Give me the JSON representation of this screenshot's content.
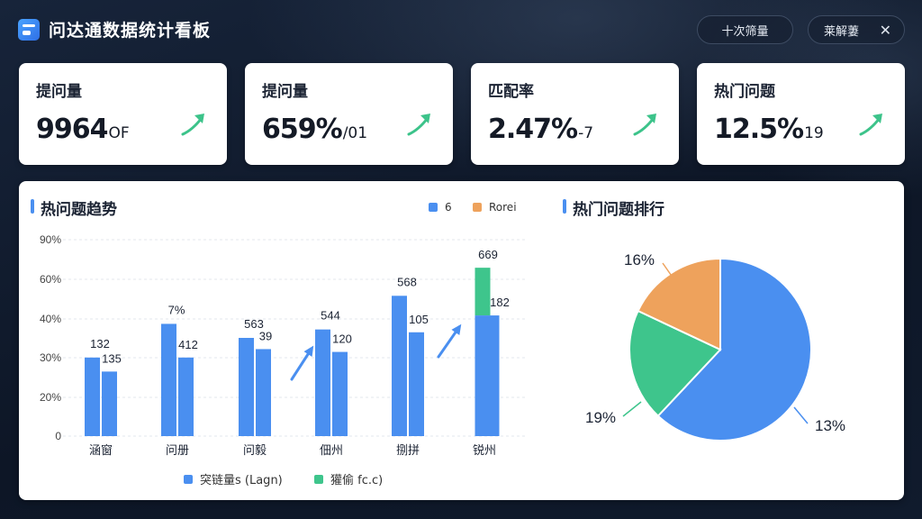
{
  "header": {
    "title": "问达通数据统计看板",
    "button_one": "十次筛量",
    "button_two": "莱解萋",
    "close_glyph": "✕"
  },
  "kpis": [
    {
      "label": "提问量",
      "value": "9964",
      "suffix": "OF",
      "trend_icon": "up-arrow-icon"
    },
    {
      "label": "提问量",
      "value": "659%",
      "suffix": "/01",
      "trend_icon": "up-arrow-icon"
    },
    {
      "label": "匹配率",
      "value": "2.47%",
      "suffix": "-7",
      "trend_icon": "up-arrow-icon"
    },
    {
      "label": "热门问题",
      "value": "12.5%",
      "suffix": "19",
      "trend_icon": "up-arrow-icon"
    }
  ],
  "trend_section": {
    "title": "热问题趋势",
    "legend_top": [
      {
        "label": "6",
        "color": "#4a8ff0"
      },
      {
        "label": "Rorei",
        "color": "#eea25c"
      }
    ],
    "legend_bottom": [
      {
        "label": "突链量s (Lagn)",
        "color": "#4a8ff0"
      },
      {
        "label": "獾偷 fc.c)",
        "color": "#3ec58c"
      }
    ]
  },
  "ranking_section": {
    "title": "热门问题排行"
  },
  "colors": {
    "blue": "#4a8ff0",
    "green": "#3ec58c",
    "orange": "#eea25c",
    "trend_green": "#3cc38a"
  },
  "chart_data": [
    {
      "type": "bar",
      "title": "热问题趋势",
      "y_ticks": [
        "0",
        "20%",
        "30%",
        "40%",
        "60%",
        "90%"
      ],
      "categories": [
        "涵窗",
        "问册",
        "问毅",
        "佃州",
        "捌拼",
        "锐州"
      ],
      "series": [
        {
          "values": [
            28,
            40,
            35,
            38,
            50,
            43
          ],
          "color": "#4a8ff0"
        },
        {
          "values": [
            23,
            28,
            31,
            30,
            37,
            null
          ],
          "color": "#4a8ff0"
        },
        {
          "values": [
            null,
            null,
            null,
            null,
            null,
            60
          ],
          "color": "#3ec58c"
        }
      ],
      "data_labels": [
        [
          "132",
          "135"
        ],
        [
          "7%",
          "412"
        ],
        [
          "563",
          "39"
        ],
        [
          "544",
          "120"
        ],
        [
          "568",
          "105"
        ],
        [
          "669",
          "182"
        ]
      ],
      "ylim": [
        0,
        70
      ],
      "grid": true
    },
    {
      "type": "pie",
      "title": "热门问题排行",
      "slices": [
        {
          "label": "13%",
          "value": 62,
          "color": "#4a8ff0"
        },
        {
          "label": "19%",
          "value": 20,
          "color": "#3ec58c"
        },
        {
          "label": "16%",
          "value": 18,
          "color": "#eea25c"
        }
      ]
    }
  ]
}
